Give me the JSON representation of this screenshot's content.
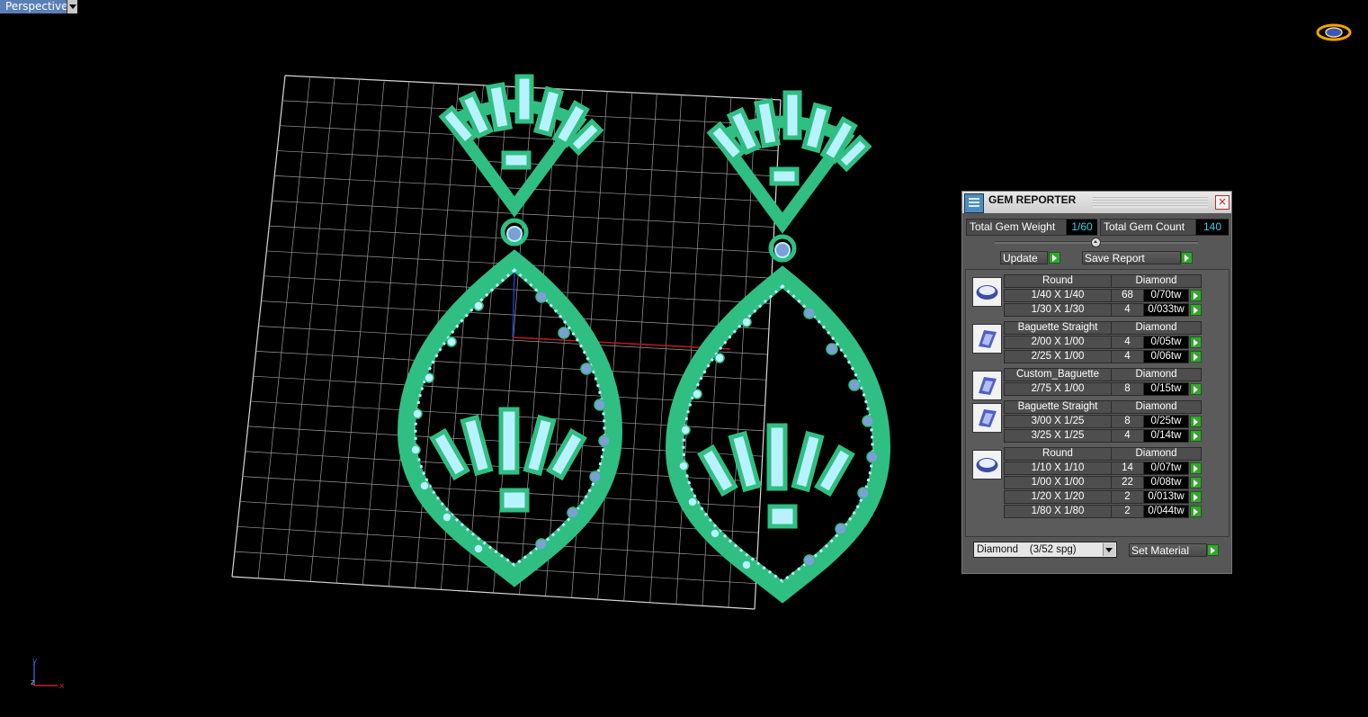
{
  "viewport": {
    "label": "Perspective",
    "axis_x": "x",
    "axis_y": "y",
    "axis_z": "z"
  },
  "icons": {
    "viewport_menu": "chevron-down-icon",
    "navigation": "orbit-ring-icon",
    "gem_thumbnails": [
      "round-gem-icon",
      "baguette-gem-icon"
    ]
  },
  "colors": {
    "background": "#000000",
    "grid": "#bdbdbd",
    "metal": "#2fbf82",
    "gem_light": "#b8f2ff",
    "gem_blue": "#7d9fd8",
    "panel": "#575757",
    "value_text": "#3fcfe6",
    "go_button": "#35a52f"
  },
  "gem_reporter": {
    "title": "GEM REPORTER",
    "total_weight_label": "Total Gem Weight",
    "total_weight_value": "1/60",
    "total_count_label": "Total Gem Count",
    "total_count_value": "140",
    "update_label": "Update",
    "save_report_label": "Save Report",
    "groups": [
      {
        "shape": "Round",
        "material": "Diamond",
        "icon": "round-gem-icon",
        "rows": [
          {
            "size": "1/40 X 1/40",
            "count": "68",
            "weight": "0/70tw"
          },
          {
            "size": "1/30 X 1/30",
            "count": "4",
            "weight": "0/033tw"
          }
        ]
      },
      {
        "shape": "Baguette Straight",
        "material": "Diamond",
        "icon": "baguette-gem-icon",
        "rows": [
          {
            "size": "2/00 X 1/00",
            "count": "4",
            "weight": "0/05tw"
          },
          {
            "size": "2/25 X 1/00",
            "count": "4",
            "weight": "0/06tw"
          }
        ]
      },
      {
        "shape": "Custom_Baguette",
        "material": "Diamond",
        "icon": "baguette-gem-icon",
        "rows": [
          {
            "size": "2/75 X 1/00",
            "count": "8",
            "weight": "0/15tw"
          }
        ]
      },
      {
        "shape": "Baguette Straight",
        "material": "Diamond",
        "icon": "baguette-gem-icon",
        "rows": [
          {
            "size": "3/00 X 1/25",
            "count": "8",
            "weight": "0/25tw"
          },
          {
            "size": "3/25 X 1/25",
            "count": "4",
            "weight": "0/14tw"
          }
        ]
      },
      {
        "shape": "Round",
        "material": "Diamond",
        "icon": "round-gem-icon",
        "rows": [
          {
            "size": "1/10 X 1/10",
            "count": "14",
            "weight": "0/07tw"
          },
          {
            "size": "1/00 X 1/00",
            "count": "22",
            "weight": "0/08tw"
          },
          {
            "size": "1/20 X 1/20",
            "count": "2",
            "weight": "0/013tw"
          },
          {
            "size": "1/80 X 1/80",
            "count": "2",
            "weight": "0/044tw"
          }
        ]
      }
    ],
    "material_select": "Diamond    (3/52 spg)",
    "set_material_label": "Set Material"
  }
}
